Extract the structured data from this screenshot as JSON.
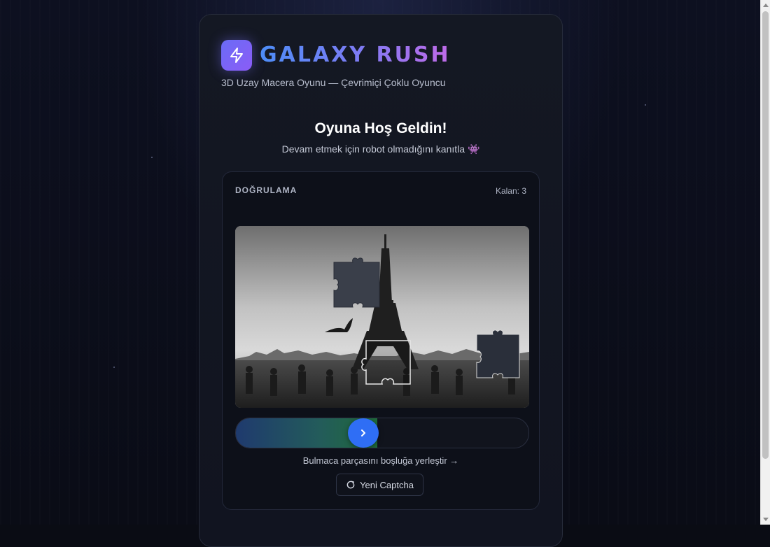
{
  "brand": {
    "name": "GALAXY RUSH",
    "tagline": "3D Uzay Macera Oyunu — Çevrimiçi Çoklu Oyuncu",
    "logo_icon": "lightning-icon",
    "gradient": [
      "#4d8df7",
      "#7b7cf4",
      "#c06ae8"
    ]
  },
  "welcome": {
    "title": "Oyuna Hoş Geldin!",
    "subtitle": "Devam etmek için robot olmadığını kanıtla",
    "emoji": "👾"
  },
  "captcha": {
    "title": "DOĞRULAMA",
    "remaining_label": "Kalan: 3",
    "image_subject": "Eiffel Tower black-and-white photo",
    "slider_progress_percent": 43,
    "hint": "Bulmaca parçasını boşluğa yerleştir →",
    "refresh_label": "Yeni Captcha",
    "refresh_icon": "refresh-icon",
    "handle_icon": "chevron-right-icon"
  },
  "colors": {
    "accent": "#2f6ef5",
    "card_bg": "#141823",
    "page_bg": "#0a0c14"
  }
}
